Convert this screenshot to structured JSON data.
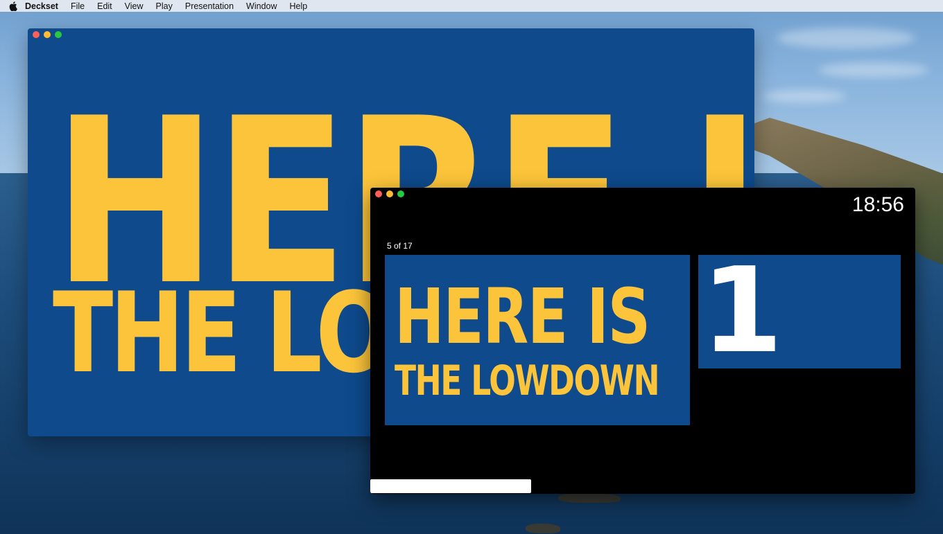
{
  "menubar": {
    "app_name": "Deckset",
    "items": [
      "File",
      "Edit",
      "View",
      "Play",
      "Presentation",
      "Window",
      "Help"
    ]
  },
  "main_window": {
    "slide_text_line1": "HERE IS",
    "slide_text_line2": "THE LOWDOWN",
    "background_color": "#0e4a8c",
    "text_color": "#fbc43a"
  },
  "presenter_window": {
    "clock": "18:56",
    "slide_counter": "5 of 17",
    "current_slide": {
      "line1": "HERE IS",
      "line2": "THE LOWDOWN"
    },
    "next_slide": {
      "text": "1"
    }
  },
  "icons": [
    "apple-icon",
    "close-icon",
    "minimize-icon",
    "zoom-icon"
  ]
}
